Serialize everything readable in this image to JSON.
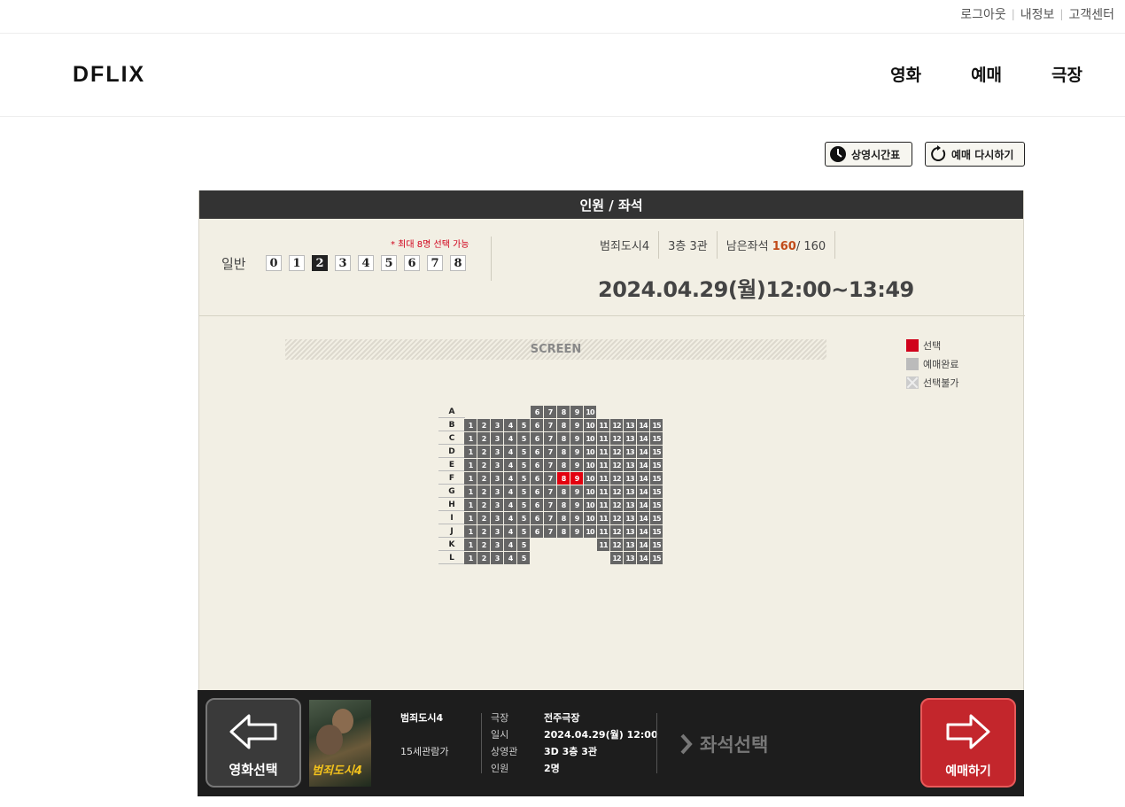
{
  "util_links": [
    "로그아웃",
    "내정보",
    "고객센터"
  ],
  "brand": {
    "logo": "DFLIX"
  },
  "nav": [
    "영화",
    "예매",
    "극장"
  ],
  "tools": {
    "schedule": "상영시간표",
    "reset": "예매 다시하기"
  },
  "steps_title": "인원 / 좌석",
  "people": {
    "max_note": "* 최대 8명 선택 가능",
    "label": "일반",
    "options": [
      "0",
      "1",
      "2",
      "3",
      "4",
      "5",
      "6",
      "7",
      "8"
    ],
    "selected": "2"
  },
  "movie_meta": {
    "title": "범죄도시4",
    "hall": "3층 3관",
    "remain_label": "남은좌석",
    "remain": "160",
    "total": "/ 160",
    "showtime": "2024.04.29(월)12:00~13:49"
  },
  "screen_label": "SCREEN",
  "legend": [
    "선택",
    "예매완료",
    "선택불가"
  ],
  "seat_rows": [
    {
      "row": "A",
      "seats": [
        "6",
        "7",
        "8",
        "9",
        "10"
      ]
    },
    {
      "row": "B",
      "seats": [
        "1",
        "2",
        "3",
        "4",
        "5",
        "6",
        "7",
        "8",
        "9",
        "10",
        "11",
        "12",
        "13",
        "14",
        "15"
      ]
    },
    {
      "row": "C",
      "seats": [
        "1",
        "2",
        "3",
        "4",
        "5",
        "6",
        "7",
        "8",
        "9",
        "10",
        "11",
        "12",
        "13",
        "14",
        "15"
      ]
    },
    {
      "row": "D",
      "seats": [
        "1",
        "2",
        "3",
        "4",
        "5",
        "6",
        "7",
        "8",
        "9",
        "10",
        "11",
        "12",
        "13",
        "14",
        "15"
      ]
    },
    {
      "row": "E",
      "seats": [
        "1",
        "2",
        "3",
        "4",
        "5",
        "6",
        "7",
        "8",
        "9",
        "10",
        "11",
        "12",
        "13",
        "14",
        "15"
      ]
    },
    {
      "row": "F",
      "seats": [
        "1",
        "2",
        "3",
        "4",
        "5",
        "6",
        "7",
        "8",
        "9",
        "10",
        "11",
        "12",
        "13",
        "14",
        "15"
      ],
      "selected": [
        "8",
        "9"
      ]
    },
    {
      "row": "G",
      "seats": [
        "1",
        "2",
        "3",
        "4",
        "5",
        "6",
        "7",
        "8",
        "9",
        "10",
        "11",
        "12",
        "13",
        "14",
        "15"
      ]
    },
    {
      "row": "H",
      "seats": [
        "1",
        "2",
        "3",
        "4",
        "5",
        "6",
        "7",
        "8",
        "9",
        "10",
        "11",
        "12",
        "13",
        "14",
        "15"
      ]
    },
    {
      "row": "I",
      "seats": [
        "1",
        "2",
        "3",
        "4",
        "5",
        "6",
        "7",
        "8",
        "9",
        "10",
        "11",
        "12",
        "13",
        "14",
        "15"
      ]
    },
    {
      "row": "J",
      "seats": [
        "1",
        "2",
        "3",
        "4",
        "5",
        "6",
        "7",
        "8",
        "9",
        "10",
        "11",
        "12",
        "13",
        "14",
        "15"
      ]
    },
    {
      "row": "K",
      "seats": [
        "1",
        "2",
        "3",
        "4",
        "5",
        "11",
        "12",
        "13",
        "14",
        "15"
      ]
    },
    {
      "row": "L",
      "seats": [
        "1",
        "2",
        "3",
        "4",
        "5",
        "12",
        "13",
        "14",
        "15"
      ]
    }
  ],
  "footer": {
    "prev_label": "영화선택",
    "poster_title": "범죄도시4",
    "movie": "범죄도시4",
    "rating": "15세관람가",
    "info": [
      {
        "k": "극장",
        "v": "전주극장"
      },
      {
        "k": "일시",
        "v": "2024.04.29(월) 12:00"
      },
      {
        "k": "상영관",
        "v": "3D 3층 3관"
      },
      {
        "k": "인원",
        "v": "2명"
      }
    ],
    "step_label": "좌석선택",
    "next_label": "예매하기"
  },
  "colors": {
    "accent": "#c3262c",
    "selected_seat": "#e3000f",
    "seat": "#666666",
    "remain": "#c14a18"
  }
}
